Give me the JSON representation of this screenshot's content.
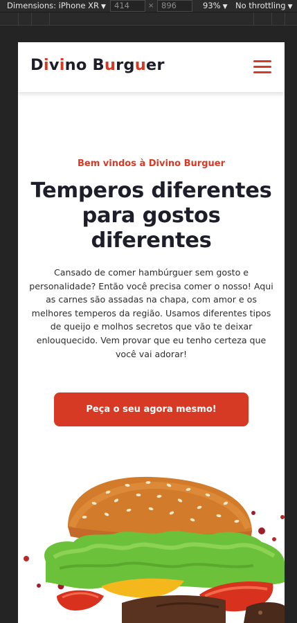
{
  "devtools": {
    "device_label": "Dimensions: iPhone XR",
    "width_value": "414",
    "height_value": "896",
    "times_symbol": "×",
    "zoom_label": "93%",
    "throttle_label": "No throttling"
  },
  "header": {
    "logo_parts": [
      "D",
      "i",
      "v",
      "i",
      "no B",
      "u",
      "rg",
      "u",
      "er"
    ]
  },
  "hero": {
    "eyebrow": "Bem vindos à Divino Burguer",
    "title": "Temperos diferentes para gostos diferentes",
    "description": "Cansado de comer hambúrguer sem gosto e personalidade? Então você precisa comer o nosso! Aqui as carnes são assadas na chapa, com amor e os melhores temperos da região. Usamos diferentes tipos de queijo e molhos secretos que vão te deixar enlouquecido. Vem provar que eu tenho certeza que você vai adorar!",
    "cta_label": "Peça o seu agora mesmo!"
  },
  "colors": {
    "accent": "#d63a25",
    "text_dark": "#1e1e2a"
  }
}
